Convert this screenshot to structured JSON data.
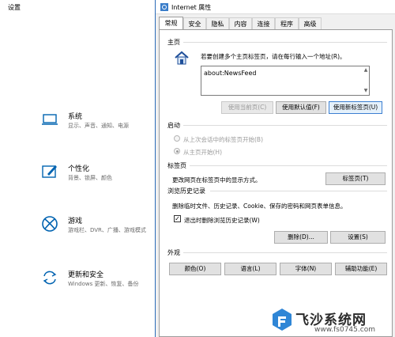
{
  "settings": {
    "title": "设置",
    "categories": [
      {
        "icon": "laptop-icon",
        "title": "系统",
        "sub": "显示、声音、通知、电源"
      },
      {
        "icon": "paint-icon",
        "title": "个性化",
        "sub": "背景、锁屏、颜色"
      },
      {
        "icon": "xbox-icon",
        "title": "游戏",
        "sub": "游戏栏、DVR、广播、游戏模式"
      },
      {
        "icon": "update-icon",
        "title": "更新和安全",
        "sub": "Windows 更新、恢复、备份"
      }
    ]
  },
  "dialog": {
    "title": "Internet 属性",
    "tabs": [
      "常规",
      "安全",
      "隐私",
      "内容",
      "连接",
      "程序",
      "高级"
    ],
    "homepage": {
      "label": "主页",
      "description": "若要创建多个主页标签页，请在每行输入一个地址(R)。",
      "value": "about:NewsFeed",
      "btn_current": "使用当前页(C)",
      "btn_default": "使用默认值(F)",
      "btn_newtab": "使用新标签页(U)"
    },
    "startup": {
      "label": "启动",
      "option_last": "从上次会话中的标签页开始(B)",
      "option_home": "从主页开始(H)"
    },
    "tabs_group": {
      "label": "标签页",
      "description": "更改网页在标签页中的显示方式。",
      "button": "标签页(T)"
    },
    "history": {
      "label": "浏览历史记录",
      "description": "删除临时文件、历史记录、Cookie、保存的密码和网页表单信息。",
      "checkbox": "退出时删除浏览历史记录(W)",
      "btn_delete": "删除(D)...",
      "btn_settings": "设置(S)"
    },
    "appearance": {
      "label": "外观",
      "btn_colors": "颜色(O)",
      "btn_languages": "语言(L)",
      "btn_fonts": "字体(N)",
      "btn_accessibility": "辅助功能(E)"
    }
  },
  "watermark": {
    "title": "飞沙系统网",
    "url": "www.fs0745.com"
  },
  "colors": {
    "accent": "#0063b1",
    "dialog_bg": "#f0f0f0",
    "focus_border": "#3c7fd1"
  }
}
